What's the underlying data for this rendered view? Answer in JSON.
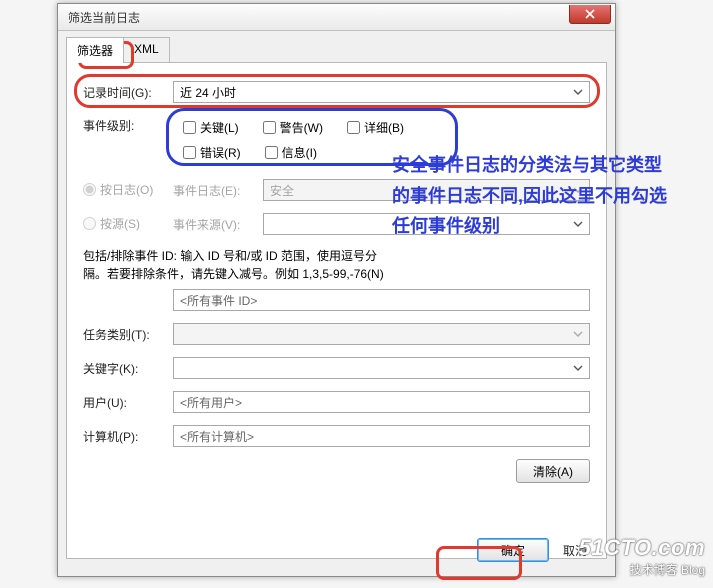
{
  "window": {
    "title": "筛选当前日志",
    "close_icon": "close-icon"
  },
  "tabs": {
    "filter": "筛选器",
    "xml": "XML"
  },
  "time": {
    "label": "记录时间(G):",
    "value": "近 24 小时"
  },
  "levels": {
    "label": "事件级别:",
    "critical": "关键(L)",
    "warning": "警告(W)",
    "verbose": "详细(B)",
    "error": "错误(R)",
    "information": "信息(I)"
  },
  "radios": {
    "by_log": "按日志(O)",
    "by_source": "按源(S)"
  },
  "event_log": {
    "label": "事件日志(E):",
    "value": "安全"
  },
  "event_source": {
    "label": "事件来源(V):",
    "value": ""
  },
  "include_exclude_help": "包括/排除事件 ID: 输入 ID 号和/或 ID 范围，使用逗号分隔。若要排除条件，请先键入减号。例如 1,3,5-99,-76(N)",
  "event_id_placeholder": "<所有事件 ID>",
  "task_category": {
    "label": "任务类别(T):"
  },
  "keywords": {
    "label": "关键字(K):"
  },
  "user": {
    "label": "用户(U):",
    "value": "<所有用户>"
  },
  "computer": {
    "label": "计算机(P):",
    "value": "<所有计算机>"
  },
  "buttons": {
    "clear": "清除(A)",
    "ok": "确定",
    "cancel": "取消"
  },
  "callout_text": "安全事件日志的分类法与其它类型的事件日志不同,因此这里不用勾选任何事件级别",
  "watermark": {
    "line1": "51CTO.com",
    "line2": "技术博客    Blog"
  }
}
